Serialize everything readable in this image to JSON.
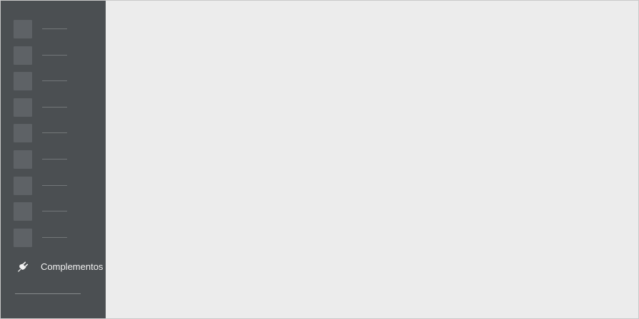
{
  "sidebar": {
    "placeholder_count": 9,
    "addons": {
      "label": "Complementos",
      "icon": "plug-icon"
    }
  },
  "colors": {
    "sidebar_bg": "#4b4f52",
    "content_bg": "#ececec",
    "placeholder_block": "#5e6266",
    "placeholder_line": "#737779",
    "label_text": "#f2f2f2"
  }
}
